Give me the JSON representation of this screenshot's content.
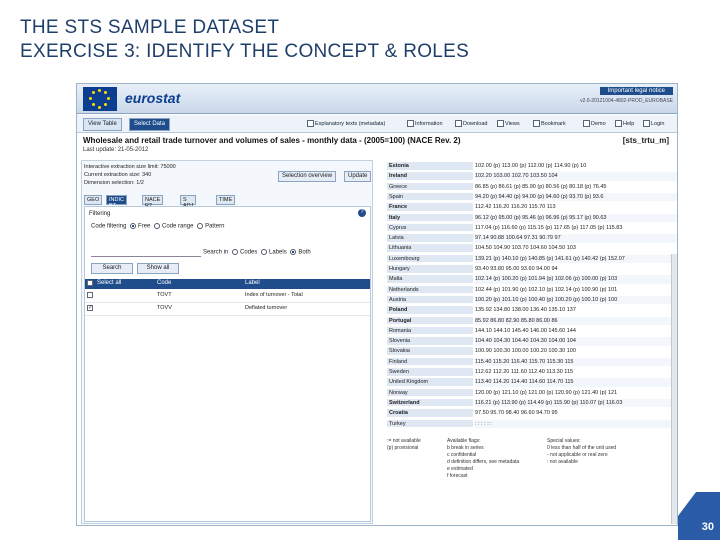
{
  "slide": {
    "title_line1": "THE STS SAMPLE DATASET",
    "title_line2": "EXERCISE 3: IDENTIFY THE CONCEPT & ROLES",
    "page_number": "30"
  },
  "eurostat": {
    "logo": "eurostat",
    "legal_notice": "Important legal notice",
    "tagline": "v2.6-20121004-4802-PROD_EUROBASE"
  },
  "toolbar": {
    "tab_view": "View Table",
    "tab_select": "Select Data",
    "tools": [
      "Explanatory texts (metadata)",
      "Information",
      "Download",
      "Views",
      "Bookmark",
      "Demo",
      "Help",
      "Login"
    ]
  },
  "dataset": {
    "title": "Wholesale and retail trade turnover and volumes of sales - monthly data - (2005=100) (NACE Rev. 2)",
    "code": "[sts_trtu_m]",
    "last_update": "Last update: 21-05-2012"
  },
  "selection": {
    "info_lines": [
      "Interactive extraction size limit: 75000",
      "Current extraction size: 340",
      "Dimension selection: 1/2"
    ],
    "overview_button": "Selection overview",
    "update_button": "Update",
    "dim_tabs": [
      "GEO",
      "INDIC BT",
      "NACE R2",
      "S ADJ",
      "TIME"
    ],
    "filtering_label": "Filtering",
    "filter_label": "Code filtering",
    "filter_options": [
      "Free",
      "Code range",
      "Pattern"
    ],
    "search_label": "Search in",
    "search_options": [
      "Codes",
      "Labels",
      "Both"
    ],
    "search_button": "Search",
    "show_all_button": "Show all",
    "grid_headers": [
      "Select all",
      "Code",
      "Label"
    ],
    "grid_rows": [
      {
        "code": "TOVT",
        "label": "Index of turnover - Total",
        "checked": false
      },
      {
        "code": "TOVV",
        "label": "Deflated turnover",
        "checked": true
      }
    ]
  },
  "table": {
    "rows": [
      {
        "country": "Estonia",
        "bold": true,
        "values": "102.00 (p)  113.00 (p)  112.00 (p)  114.90 (p)  10"
      },
      {
        "country": "Ireland",
        "bold": true,
        "values": "102.20  103.00  102.70  103.50  104"
      },
      {
        "country": "Greece",
        "bold": false,
        "values": "86.85 (p)  86.61 (p)  85.90 (p)  80.56 (p)  80.18 (p)  76.45"
      },
      {
        "country": "Spain",
        "bold": false,
        "values": "94.20 (p)  94.40 (p)  94.00 (p)  94.60 (p)  93.70 (p)  93.6"
      },
      {
        "country": "France",
        "bold": true,
        "values": "112.42  116.20  116.20  115.70  113"
      },
      {
        "country": "Italy",
        "bold": true,
        "values": "96.12 (p)  95.00 (p)  95.46 (p)  96.96 (p)  95.17 (p)  90.63"
      },
      {
        "country": "Cyprus",
        "bold": false,
        "values": "117.04 (p)  116.60 (p)  115.15 (p)  117.65 (p)  117.05 (p)  115.83"
      },
      {
        "country": "Latvia",
        "bold": false,
        "values": "97.14  90.88  100.64  97.31  90.79  97"
      },
      {
        "country": "Lithuania",
        "bold": false,
        "values": "104.50  104.90  103.70  104.60  104.50  103"
      },
      {
        "country": "Luxembourg",
        "bold": false,
        "values": "139.21 (p)  140.10 (p)  140.85 (p)  141.61 (p)  140.42 (p)  152.07"
      },
      {
        "country": "Hungary",
        "bold": false,
        "values": "93.40  93.80  95.00  93.60  94.00  94"
      },
      {
        "country": "Malta",
        "bold": false,
        "values": "102.14 (p)  100.20 (p)  101.94 (p)  102.06 (p)  100.00 (p)  103"
      },
      {
        "country": "Netherlands",
        "bold": false,
        "values": "102.44 (p)  101.90 (p)  102.10 (p)  102.14 (p)  100.90 (p)  101"
      },
      {
        "country": "Austria",
        "bold": false,
        "values": "100.20 (p)  101.10 (p)  100.40 (p)  100.20 (p)  100.10 (p)  100"
      },
      {
        "country": "Poland",
        "bold": true,
        "values": "135.92  134.80  138.00  136.40  135.10  137"
      },
      {
        "country": "Portugal",
        "bold": true,
        "values": "85.92  86.80  82.90  85.80  86.00  86"
      },
      {
        "country": "Romania",
        "bold": false,
        "values": "144.10  144.10  145.40  146.00  145.60  144"
      },
      {
        "country": "Slovenia",
        "bold": false,
        "values": "104.40  104.30  104.40  104.30  104.00  104"
      },
      {
        "country": "Slovakia",
        "bold": false,
        "values": "100.90  100.30  100.00  100.20  100.30  100"
      },
      {
        "country": "Finland",
        "bold": false,
        "values": "115.40  115.20  116.40  115.70  115.30  115"
      },
      {
        "country": "Sweden",
        "bold": false,
        "values": "112.62  112.20  111.60  112.40  113.30  115"
      },
      {
        "country": "United Kingdom",
        "bold": false,
        "values": "113.40  114.20  114.40  114.60  114.70  115"
      },
      {
        "country": "Norway",
        "bold": false,
        "values": "120.00 (p)  121.10 (p)  121.00 (p)  120.90 (p)  121.40 (p)  121"
      },
      {
        "country": "Switzerland",
        "bold": true,
        "values": "116.21 (p)  113.90 (p)  114.49 (p)  115.90 (p)  110.07 (p)  116.03"
      },
      {
        "country": "Croatia",
        "bold": true,
        "values": "97.50  95.70  98.40  96.60  94.70  95"
      },
      {
        "country": "Turkey",
        "bold": false,
        "values": ":  :  :  :  :  :"
      }
    ],
    "legend": {
      "col1": [
        ":= not available",
        "(p) provisional"
      ],
      "col2": [
        "Available flags:",
        "b break in series",
        "c confidential",
        "d definition differs, see metadata",
        "e estimated",
        "f forecast"
      ],
      "col3": [
        "Special values:",
        "0 less than half of the unit used",
        "- not applicable or real zero",
        ": not available"
      ]
    }
  }
}
